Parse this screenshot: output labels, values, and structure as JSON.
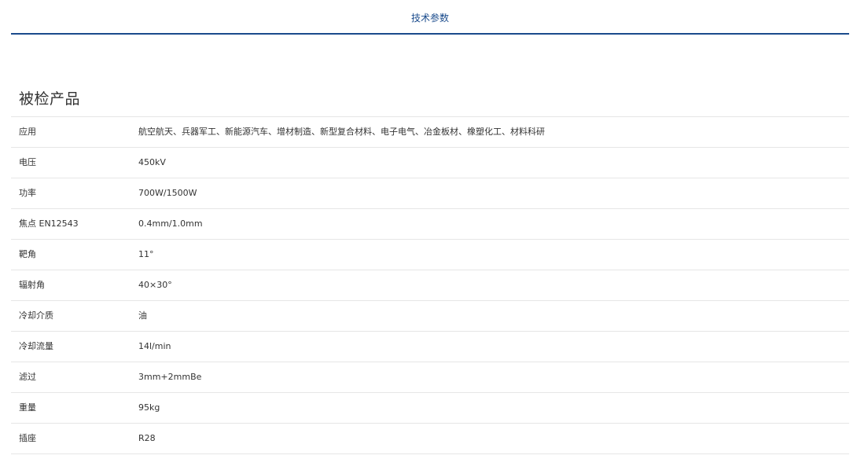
{
  "tabs": {
    "active_label": "技术参数"
  },
  "section": {
    "title": "被检产品"
  },
  "specs": [
    {
      "label": "应用",
      "value": "航空航天、兵器军工、新能源汽车、增材制造、新型复合材料、电子电气、冶金板材、橡塑化工、材料科研"
    },
    {
      "label": "电压",
      "value": "450kV"
    },
    {
      "label": "功率",
      "value": "700W/1500W"
    },
    {
      "label": "焦点 EN12543",
      "value": "0.4mm/1.0mm"
    },
    {
      "label": "靶角",
      "value": "11°"
    },
    {
      "label": "辐射角",
      "value": "40×30°"
    },
    {
      "label": "冷却介质",
      "value": "油"
    },
    {
      "label": "冷却流量",
      "value": "14l/min"
    },
    {
      "label": "滤过",
      "value": "3mm+2mmBe"
    },
    {
      "label": "重量",
      "value": "95kg"
    },
    {
      "label": "插座",
      "value": "R28"
    }
  ]
}
